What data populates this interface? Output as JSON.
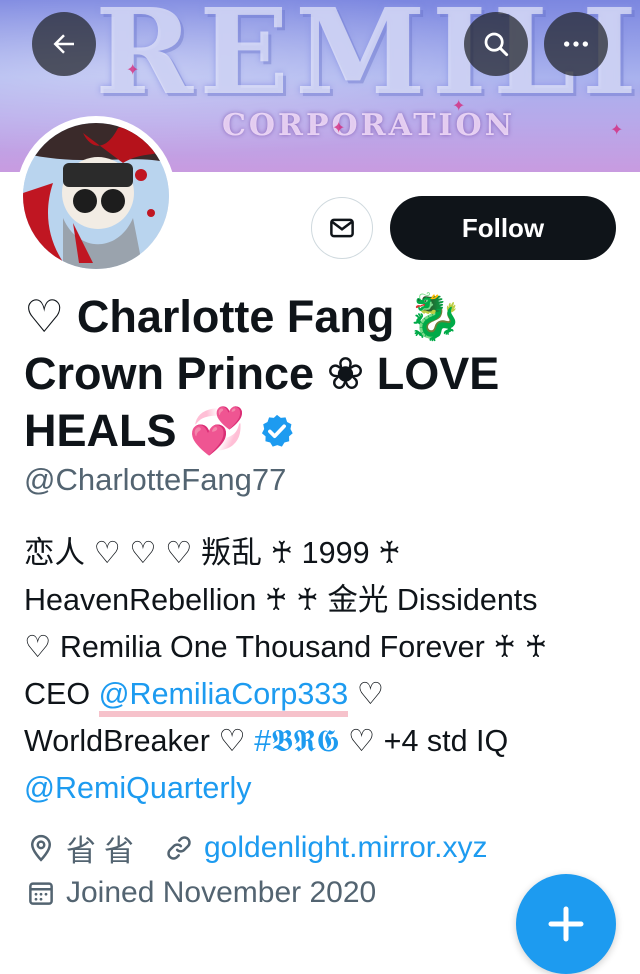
{
  "banner": {
    "wordmark": "REMILIA",
    "subtitle": "CORPORATION"
  },
  "nav": {
    "back_icon": "arrow-left-icon",
    "search_icon": "search-icon",
    "more_icon": "ellipsis-icon"
  },
  "actions": {
    "message_icon": "envelope-icon",
    "follow_label": "Follow"
  },
  "profile": {
    "name_line1": "♡ Charlotte Fang 🐉",
    "name_line2": "Crown Prince ❀ LOVE",
    "name_line3": "HEALS 💞",
    "verified": true,
    "handle": "@CharlotteFang77"
  },
  "bio": {
    "line1": "恋人 ♡ ♡ ♡ 叛乱 ♰ 1999 ♰",
    "line2": "HeavenRebellion ♰ ♰ 金光 Dissidents",
    "line3": "♡ Remilia One Thousand Forever ♰ ♰",
    "line4_pre": "CEO ",
    "line4_link": "@RemiliaCorp333",
    "line4_post": " ♡",
    "line5_pre": "WorldBreaker ♡ ",
    "line5_tag": "#𝕭𝕽𝕲",
    "line5_post": " ♡ +4 std IQ",
    "line6_link": "@RemiQuarterly"
  },
  "meta": {
    "location": "省省",
    "website": "goldenlight.mirror.xyz",
    "joined": "Joined November 2020"
  },
  "colors": {
    "accent": "#1d9bf0",
    "text": "#0f1419",
    "secondary": "#536471",
    "follow_bg": "#0f1419"
  }
}
